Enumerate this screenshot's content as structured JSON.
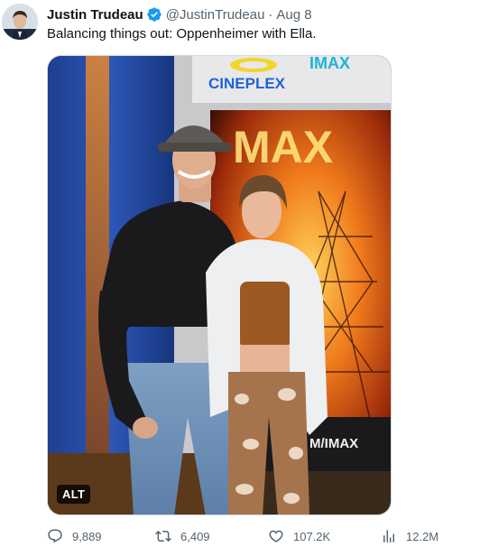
{
  "author": {
    "name": "Justin Trudeau",
    "handle": "@JustinTrudeau",
    "separator": "·",
    "date": "Aug 8"
  },
  "tweet": {
    "text": "Balancing things out: Oppenheimer with Ella."
  },
  "media": {
    "alt_label": "ALT",
    "sign_text": "CINEPLEX",
    "imax_text": "IMAX",
    "poster_text": "MAX",
    "lower_sign_text": "M/IMAX"
  },
  "actions": {
    "replies": "9,889",
    "reposts": "6,409",
    "likes": "107.2K",
    "views": "12.2M"
  },
  "colors": {
    "verified": "#1d9bf0",
    "muted_text": "#536471",
    "icon": "#536471"
  }
}
